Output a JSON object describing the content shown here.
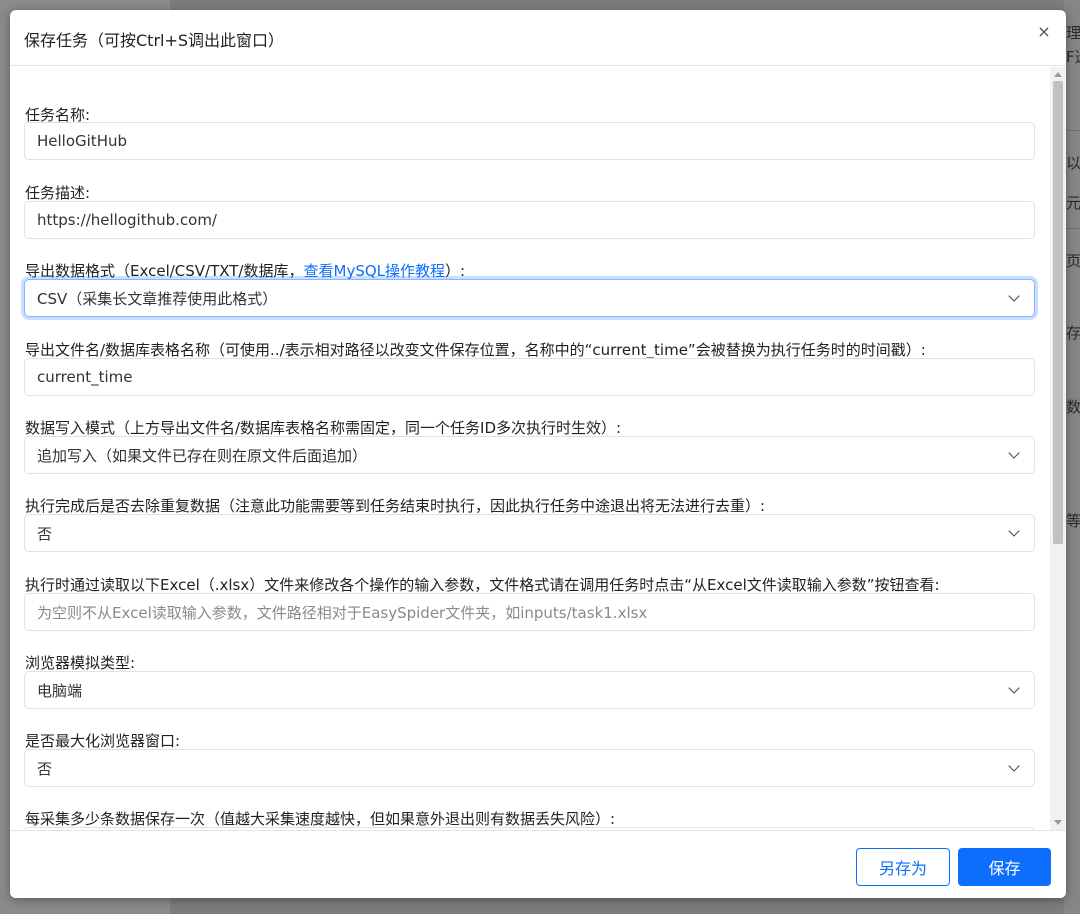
{
  "background": {
    "fragments": [
      "理",
      "F选",
      "以下",
      "元",
      "页面",
      "存",
      "数",
      "等"
    ]
  },
  "dialog": {
    "title": "保存任务（可按Ctrl+S调出此窗口）",
    "close_label": "×",
    "fields": {
      "task_name": {
        "label": "任务名称:",
        "value": "HelloGitHub"
      },
      "task_desc": {
        "label": "任务描述:",
        "value": "https://hellogithub.com/"
      },
      "export_format": {
        "label_prefix": "导出数据格式（Excel/CSV/TXT/数据库，",
        "label_link": "查看MySQL操作教程",
        "label_suffix": "）:",
        "value": "CSV（采集长文章推荐使用此格式）"
      },
      "export_filename": {
        "label": "导出文件名/数据库表格名称（可使用../表示相对路径以改变文件保存位置，名称中的“current_time”会被替换为执行任务时的时间戳）:",
        "value": "current_time"
      },
      "write_mode": {
        "label": "数据写入模式（上方导出文件名/数据库表格名称需固定，同一个任务ID多次执行时生效）:",
        "value": "追加写入（如果文件已存在则在原文件后面追加）"
      },
      "dedupe": {
        "label": "执行完成后是否去除重复数据（注意此功能需要等到任务结束时执行，因此执行任务中途退出将无法进行去重）:",
        "value": "否"
      },
      "excel_input": {
        "label": "执行时通过读取以下Excel（.xlsx）文件来修改各个操作的输入参数，文件格式请在调用任务时点击“从Excel文件读取输入参数”按钮查看:",
        "placeholder": "为空则不从Excel读取输入参数，文件路径相对于EasySpider文件夹，如inputs/task1.xlsx"
      },
      "browser_type": {
        "label": "浏览器模拟类型:",
        "value": "电脑端"
      },
      "maximize": {
        "label": "是否最大化浏览器窗口:",
        "value": "否"
      },
      "save_interval": {
        "label": "每采集多少条数据保存一次（值越大采集速度越快，但如果意外退出则有数据丢失风险）:"
      }
    },
    "buttons": {
      "save_as": "另存为",
      "save": "保存"
    }
  }
}
